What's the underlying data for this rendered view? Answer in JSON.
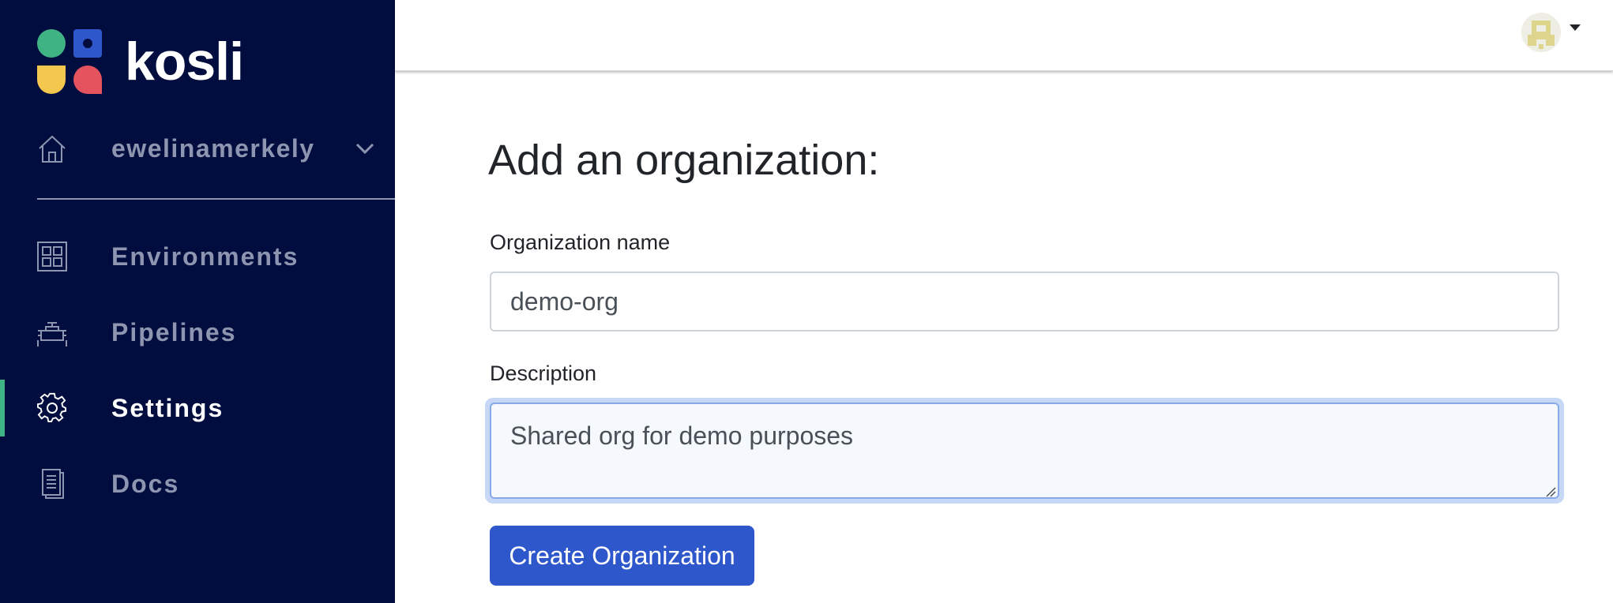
{
  "brand": {
    "name": "kosli",
    "colors": {
      "green": "#3fb384",
      "blue": "#2f57cc",
      "yellow": "#f4c84f",
      "red": "#e5535e"
    }
  },
  "sidebar": {
    "background": "#020d3f",
    "org_selector": {
      "label": "ewelinamerkely",
      "icon": "home-icon",
      "chevron": "chevron-down-icon"
    },
    "items": [
      {
        "label": "Environments",
        "icon": "grid-icon",
        "active": false
      },
      {
        "label": "Pipelines",
        "icon": "pipeline-icon",
        "active": false
      },
      {
        "label": "Settings",
        "icon": "gear-icon",
        "active": true
      },
      {
        "label": "Docs",
        "icon": "document-icon",
        "active": false
      }
    ]
  },
  "header": {
    "avatar_icon": "avatar-icon",
    "menu_icon": "caret-down-icon"
  },
  "form": {
    "title": "Add an organization:",
    "name_label": "Organization name",
    "name_value": "demo-org",
    "description_label": "Description",
    "description_value": "Shared org for demo purposes",
    "submit_label": "Create Organization"
  }
}
